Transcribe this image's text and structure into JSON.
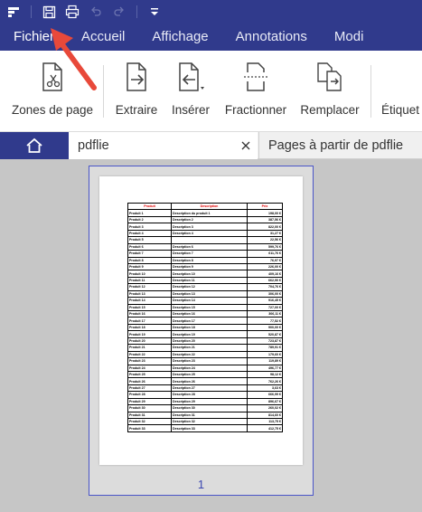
{
  "quick_access": {
    "icons": [
      "app-menu-icon",
      "save-icon",
      "print-icon",
      "undo-icon",
      "redo-icon",
      "customize-icon"
    ]
  },
  "ribbon_tabs": [
    "Fichier",
    "Accueil",
    "Affichage",
    "Annotations",
    "Modi"
  ],
  "ribbon_buttons": {
    "zones": "Zones de page",
    "extraire": "Extraire",
    "inserer": "Insérer",
    "fractionner": "Fractionner",
    "remplacer": "Remplacer",
    "etiquette": "Étiquet"
  },
  "doc_tabs": {
    "active": "pdflie",
    "other": "Pages à partir de pdflie"
  },
  "page_number": "1",
  "page_table": {
    "headers": [
      "Produit",
      "Description",
      "Prix"
    ],
    "rows": [
      [
        "Produit 1",
        "Description du produit 1",
        "198,00 €"
      ],
      [
        "Produit 2",
        "Description 2",
        "387,56 €"
      ],
      [
        "Produit 3",
        "Description 3",
        "822,00 €"
      ],
      [
        "Produit 4",
        "Description 4",
        "31,27 €"
      ],
      [
        "Produit 5",
        "",
        "22,56 €"
      ],
      [
        "Produit 6",
        "Description 6",
        "599,76 €"
      ],
      [
        "Produit 7",
        "Description 7",
        "611,76 €"
      ],
      [
        "Produit 8",
        "Description 8",
        "76,97 €"
      ],
      [
        "Produit 9",
        "Description 9",
        "226,00 €"
      ],
      [
        "Produit 10",
        "Description 10",
        "409,16 €"
      ],
      [
        "Produit 11",
        "Description 11",
        "662,90 €"
      ],
      [
        "Produit 12",
        "Description 12",
        "704,76 €"
      ],
      [
        "Produit 13",
        "Description 13",
        "306,00 €"
      ],
      [
        "Produit 14",
        "Description 14",
        "916,45 €"
      ],
      [
        "Produit 15",
        "Description 15",
        "727,00 €"
      ],
      [
        "Produit 16",
        "Description 16",
        "306,11 €"
      ],
      [
        "Produit 17",
        "Description 17",
        "77,52 €"
      ],
      [
        "Produit 18",
        "Description 18",
        "900,00 €"
      ],
      [
        "Produit 19",
        "Description 19",
        "520,87 €"
      ],
      [
        "Produit 20",
        "Description 20",
        "723,87 €"
      ],
      [
        "Produit 21",
        "Description 21",
        "789,91 €"
      ],
      [
        "Produit 22",
        "Description 22",
        "179,60 €"
      ],
      [
        "Produit 23",
        "Description 23",
        "119,89 €"
      ],
      [
        "Produit 24",
        "Description 24",
        "496,77 €"
      ],
      [
        "Produit 25",
        "Description 25",
        "98,12 €"
      ],
      [
        "Produit 26",
        "Description 26",
        "762,26 €"
      ],
      [
        "Produit 27",
        "Description 27",
        "3,63 €"
      ],
      [
        "Produit 28",
        "Description 28",
        "666,99 €"
      ],
      [
        "Produit 29",
        "Description 29",
        "896,67 €"
      ],
      [
        "Produit 30",
        "Description 30",
        "260,02 €"
      ],
      [
        "Produit 31",
        "Description 31",
        "814,60 €"
      ],
      [
        "Produit 32",
        "Description 32",
        "113,75 €"
      ],
      [
        "Produit 33",
        "Description 33",
        "412,75 €"
      ]
    ]
  },
  "colors": {
    "brand": "#303a8c",
    "annotation_arrow": "#e8493a",
    "table_header": "#e00000"
  }
}
